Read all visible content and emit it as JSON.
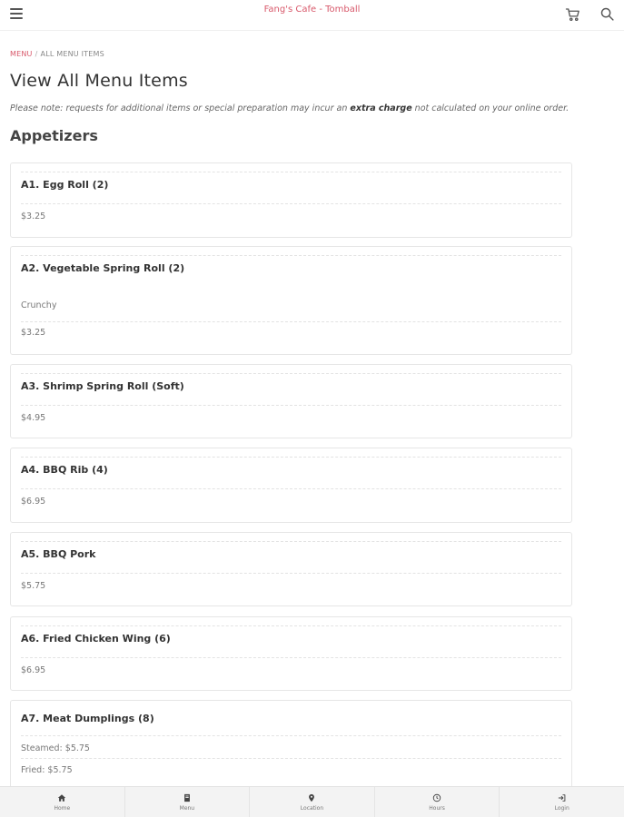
{
  "header": {
    "title": "Fang's Cafe - Tomball",
    "menu_icon": "hamburger-icon",
    "cart_icon": "cart-icon",
    "search_icon": "search-icon"
  },
  "breadcrumb": {
    "link": "MENU",
    "separator": "/",
    "current": "ALL MENU ITEMS"
  },
  "page_title": "View All Menu Items",
  "notice": {
    "before": "Please note: requests for additional items or special preparation may incur an",
    "bold": "extra charge",
    "after": "not calculated on your online order."
  },
  "section_title": "Appetizers",
  "items": [
    {
      "name": "A1. Egg Roll (2)",
      "lines": [
        "$3.25"
      ]
    },
    {
      "name": "A2. Vegetable Spring Roll (2)",
      "lines": [
        "Crunchy",
        "$3.25"
      ]
    },
    {
      "name": "A3. Shrimp Spring Roll (Soft)",
      "lines": [
        "$4.95"
      ]
    },
    {
      "name": "A4. BBQ Rib (4)",
      "lines": [
        "$6.95"
      ]
    },
    {
      "name": "A5. BBQ Pork",
      "lines": [
        "$5.75"
      ]
    },
    {
      "name": "A6. Fried Chicken Wing (6)",
      "lines": [
        "$6.95"
      ]
    },
    {
      "name": "A7. Meat Dumplings (8)",
      "lines": [
        "Steamed: $5.75",
        "Fried: $5.75"
      ]
    }
  ],
  "bottom_nav": [
    {
      "label": "Home",
      "icon": "home-icon"
    },
    {
      "label": "Menu",
      "icon": "menu-book-icon"
    },
    {
      "label": "Location",
      "icon": "location-pin-icon"
    },
    {
      "label": "Hours",
      "icon": "clock-icon"
    },
    {
      "label": "Login",
      "icon": "login-icon"
    }
  ],
  "colors": {
    "accent": "#d8596b",
    "text": "#333333",
    "muted": "#777777",
    "nav_bg": "#f3f3f3"
  }
}
